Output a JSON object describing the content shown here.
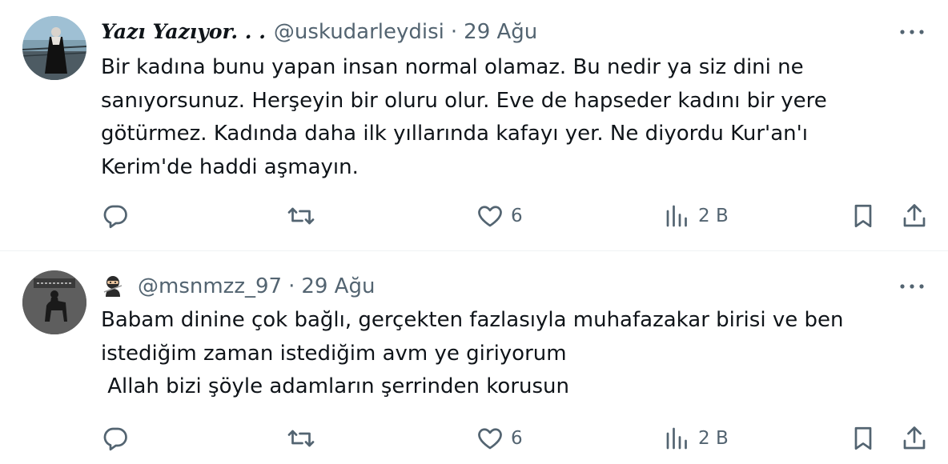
{
  "tweets": [
    {
      "display_name": "Yazı Yazıyor. . .",
      "handle": "@uskudarleydisi",
      "separator": "·",
      "date": "29 Ağu",
      "lines": [
        "Bir kadına bunu yapan insan normal olamaz. Bu nedir ya siz dini ne",
        "sanıyorsunuz. Herşeyin bir oluru olur. Eve de hapseder kadını bir yere",
        "götürmez. Kadında daha ilk yıllarında kafayı yer. Ne diyordu Kur'an'ı",
        "Kerim'de haddi aşmayın."
      ],
      "likes": "6",
      "views": "2 B"
    },
    {
      "display_name": "",
      "handle": "@msnmzz_97",
      "separator": "·",
      "date": "29 Ağu",
      "name_icon": "ninja-emoji",
      "lines": [
        "Babam dinine çok bağlı, gerçekten fazlasıyla muhafazakar birisi ve ben",
        "istediğim zaman istediğim avm ye giriyorum",
        " Allah bizi şöyle adamların şerrinden korusun"
      ],
      "likes": "6",
      "views": "2 B"
    }
  ],
  "icons": {
    "reply": "reply-icon",
    "retweet": "retweet-icon",
    "like": "heart-icon",
    "views": "views-icon",
    "bookmark": "bookmark-icon",
    "share": "share-icon",
    "more": "more-icon"
  },
  "colors": {
    "text": "#0f1419",
    "secondary": "#536471",
    "divider": "#eff3f4"
  }
}
